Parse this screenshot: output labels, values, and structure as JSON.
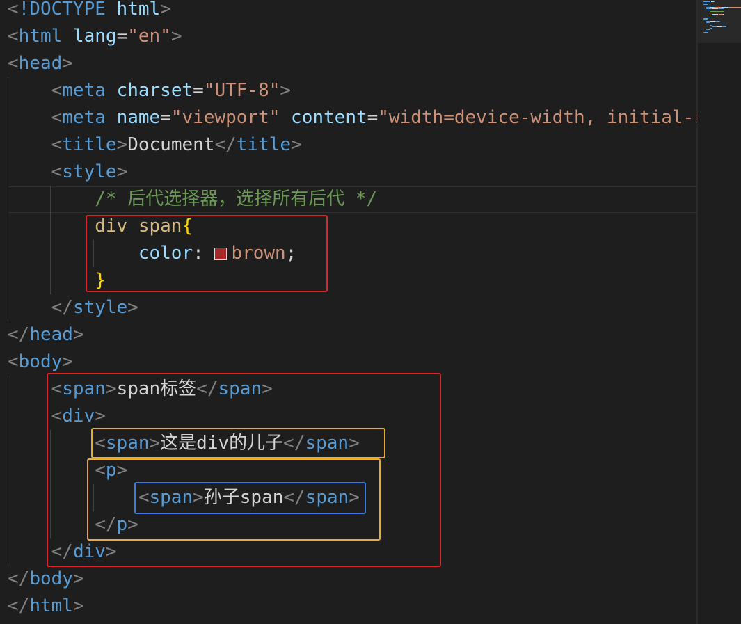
{
  "editor": {
    "lines": [
      {
        "tokens": [
          {
            "t": "<",
            "c": "t-punct"
          },
          {
            "t": "!DOCTYPE",
            "c": "t-doctype"
          },
          {
            "t": " ",
            "c": "t-text"
          },
          {
            "t": "html",
            "c": "t-attr"
          },
          {
            "t": ">",
            "c": "t-punct"
          }
        ]
      },
      {
        "tokens": [
          {
            "t": "<",
            "c": "t-punct"
          },
          {
            "t": "html",
            "c": "t-tag"
          },
          {
            "t": " ",
            "c": "t-text"
          },
          {
            "t": "lang",
            "c": "t-attr"
          },
          {
            "t": "=",
            "c": "t-text"
          },
          {
            "t": "\"en\"",
            "c": "t-str"
          },
          {
            "t": ">",
            "c": "t-punct"
          }
        ]
      },
      {
        "tokens": [
          {
            "t": "<",
            "c": "t-punct"
          },
          {
            "t": "head",
            "c": "t-tag"
          },
          {
            "t": ">",
            "c": "t-punct"
          }
        ]
      },
      {
        "tokens": [
          {
            "t": "    ",
            "c": "t-text"
          },
          {
            "t": "<",
            "c": "t-punct"
          },
          {
            "t": "meta",
            "c": "t-tag"
          },
          {
            "t": " ",
            "c": "t-text"
          },
          {
            "t": "charset",
            "c": "t-attr"
          },
          {
            "t": "=",
            "c": "t-text"
          },
          {
            "t": "\"UTF-8\"",
            "c": "t-str"
          },
          {
            "t": ">",
            "c": "t-punct"
          }
        ]
      },
      {
        "tokens": [
          {
            "t": "    ",
            "c": "t-text"
          },
          {
            "t": "<",
            "c": "t-punct"
          },
          {
            "t": "meta",
            "c": "t-tag"
          },
          {
            "t": " ",
            "c": "t-text"
          },
          {
            "t": "name",
            "c": "t-attr"
          },
          {
            "t": "=",
            "c": "t-text"
          },
          {
            "t": "\"viewport\"",
            "c": "t-str"
          },
          {
            "t": " ",
            "c": "t-text"
          },
          {
            "t": "content",
            "c": "t-attr"
          },
          {
            "t": "=",
            "c": "t-text"
          },
          {
            "t": "\"width=device-width, initial-s",
            "c": "t-str"
          }
        ]
      },
      {
        "tokens": [
          {
            "t": "    ",
            "c": "t-text"
          },
          {
            "t": "<",
            "c": "t-punct"
          },
          {
            "t": "title",
            "c": "t-tag"
          },
          {
            "t": ">",
            "c": "t-punct"
          },
          {
            "t": "Document",
            "c": "t-text"
          },
          {
            "t": "</",
            "c": "t-punct"
          },
          {
            "t": "title",
            "c": "t-tag"
          },
          {
            "t": ">",
            "c": "t-punct"
          }
        ]
      },
      {
        "tokens": [
          {
            "t": "    ",
            "c": "t-text"
          },
          {
            "t": "<",
            "c": "t-punct"
          },
          {
            "t": "style",
            "c": "t-tag"
          },
          {
            "t": ">",
            "c": "t-punct"
          }
        ]
      },
      {
        "tokens": [
          {
            "t": "        ",
            "c": "t-text"
          },
          {
            "t": "/* 后代选择器，选择所有后代 */",
            "c": "t-comment"
          }
        ]
      },
      {
        "tokens": [
          {
            "t": "        ",
            "c": "t-text"
          },
          {
            "t": "div span",
            "c": "t-sel"
          },
          {
            "t": "{",
            "c": "t-brace"
          }
        ]
      },
      {
        "tokens": [
          {
            "t": "            ",
            "c": "t-text"
          },
          {
            "t": "color",
            "c": "t-prop"
          },
          {
            "t": ": ",
            "c": "t-text"
          },
          {
            "t": "",
            "c": "swatch"
          },
          {
            "t": "brown",
            "c": "t-str"
          },
          {
            "t": ";",
            "c": "t-text"
          }
        ]
      },
      {
        "tokens": [
          {
            "t": "        ",
            "c": "t-text"
          },
          {
            "t": "}",
            "c": "t-brace"
          }
        ]
      },
      {
        "tokens": [
          {
            "t": "    ",
            "c": "t-text"
          },
          {
            "t": "</",
            "c": "t-punct"
          },
          {
            "t": "style",
            "c": "t-tag"
          },
          {
            "t": ">",
            "c": "t-punct"
          }
        ]
      },
      {
        "tokens": [
          {
            "t": "</",
            "c": "t-punct"
          },
          {
            "t": "head",
            "c": "t-tag"
          },
          {
            "t": ">",
            "c": "t-punct"
          }
        ]
      },
      {
        "tokens": [
          {
            "t": "<",
            "c": "t-punct"
          },
          {
            "t": "body",
            "c": "t-tag"
          },
          {
            "t": ">",
            "c": "t-punct"
          }
        ]
      },
      {
        "tokens": [
          {
            "t": "    ",
            "c": "t-text"
          },
          {
            "t": "<",
            "c": "t-punct"
          },
          {
            "t": "span",
            "c": "t-tag"
          },
          {
            "t": ">",
            "c": "t-punct"
          },
          {
            "t": "span标签",
            "c": "t-text"
          },
          {
            "t": "</",
            "c": "t-punct"
          },
          {
            "t": "span",
            "c": "t-tag"
          },
          {
            "t": ">",
            "c": "t-punct"
          }
        ]
      },
      {
        "tokens": [
          {
            "t": "    ",
            "c": "t-text"
          },
          {
            "t": "<",
            "c": "t-punct"
          },
          {
            "t": "div",
            "c": "t-tag"
          },
          {
            "t": ">",
            "c": "t-punct"
          }
        ]
      },
      {
        "tokens": [
          {
            "t": "        ",
            "c": "t-text"
          },
          {
            "t": "<",
            "c": "t-punct"
          },
          {
            "t": "span",
            "c": "t-tag"
          },
          {
            "t": ">",
            "c": "t-punct"
          },
          {
            "t": "这是div的儿子",
            "c": "t-text"
          },
          {
            "t": "</",
            "c": "t-punct"
          },
          {
            "t": "span",
            "c": "t-tag"
          },
          {
            "t": ">",
            "c": "t-punct"
          }
        ]
      },
      {
        "tokens": [
          {
            "t": "        ",
            "c": "t-text"
          },
          {
            "t": "<",
            "c": "t-punct"
          },
          {
            "t": "p",
            "c": "t-tag"
          },
          {
            "t": ">",
            "c": "t-punct"
          }
        ]
      },
      {
        "tokens": [
          {
            "t": "            ",
            "c": "t-text"
          },
          {
            "t": "<",
            "c": "t-punct"
          },
          {
            "t": "span",
            "c": "t-tag"
          },
          {
            "t": ">",
            "c": "t-punct"
          },
          {
            "t": "孙子span",
            "c": "t-text"
          },
          {
            "t": "</",
            "c": "t-punct"
          },
          {
            "t": "span",
            "c": "t-tag"
          },
          {
            "t": ">",
            "c": "t-punct"
          }
        ]
      },
      {
        "tokens": [
          {
            "t": "        ",
            "c": "t-text"
          },
          {
            "t": "</",
            "c": "t-punct"
          },
          {
            "t": "p",
            "c": "t-tag"
          },
          {
            "t": ">",
            "c": "t-punct"
          }
        ]
      },
      {
        "tokens": [
          {
            "t": "    ",
            "c": "t-text"
          },
          {
            "t": "</",
            "c": "t-punct"
          },
          {
            "t": "div",
            "c": "t-tag"
          },
          {
            "t": ">",
            "c": "t-punct"
          }
        ]
      },
      {
        "tokens": [
          {
            "t": "</",
            "c": "t-punct"
          },
          {
            "t": "body",
            "c": "t-tag"
          },
          {
            "t": ">",
            "c": "t-punct"
          }
        ]
      },
      {
        "tokens": [
          {
            "t": "</",
            "c": "t-punct"
          },
          {
            "t": "html",
            "c": "t-tag"
          },
          {
            "t": ">",
            "c": "t-punct"
          }
        ]
      }
    ]
  },
  "colors": {
    "background": "#1e1e1e",
    "swatch_brown": "#a52a2a",
    "highlight_red": "#d9262b",
    "highlight_orange": "#e4ad38",
    "highlight_blue": "#3c7ce2"
  }
}
